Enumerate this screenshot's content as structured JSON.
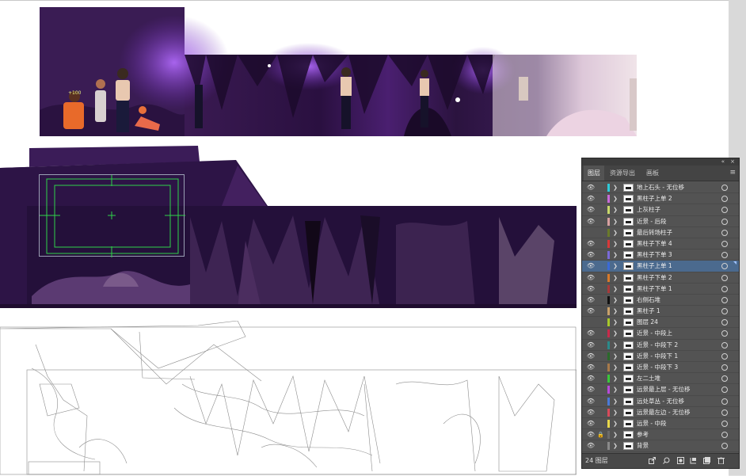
{
  "panel": {
    "collapse_icon": "double-chevron-left",
    "close_icon": "close",
    "collapse_glyph": "«",
    "close_glyph": "×",
    "tabs": [
      {
        "label": "图层",
        "active": true
      },
      {
        "label": "资源导出",
        "active": false
      },
      {
        "label": "画板",
        "active": false
      }
    ],
    "menu_icon": "hamburger",
    "menu_glyph": "≡",
    "eye_glyph": "👁",
    "lock_glyph": "🔒",
    "layers": [
      {
        "name": "地上石头 - 无位移",
        "color": "#2ecad8",
        "visible": true,
        "locked": false,
        "selected": false
      },
      {
        "name": "黑柱子上单 2",
        "color": "#c86ad8",
        "visible": true,
        "locked": false,
        "selected": false
      },
      {
        "name": "上灰柱子",
        "color": "#c8d86a",
        "visible": true,
        "locked": false,
        "selected": false
      },
      {
        "name": "近景 - 后段",
        "color": "#d8a0a0",
        "visible": true,
        "locked": false,
        "selected": false
      },
      {
        "name": "最后转场柱子",
        "color": "#6a7a2a",
        "visible": false,
        "locked": false,
        "selected": false
      },
      {
        "name": "黑柱子下单 4",
        "color": "#d83838",
        "visible": true,
        "locked": false,
        "selected": false
      },
      {
        "name": "黑柱子下单 3",
        "color": "#7a6ad8",
        "visible": true,
        "locked": false,
        "selected": false
      },
      {
        "name": "黑柱子上单 1",
        "color": "#3a6ad8",
        "visible": true,
        "locked": false,
        "selected": true
      },
      {
        "name": "黑柱子下单 2",
        "color": "#d87a2a",
        "visible": true,
        "locked": false,
        "selected": false
      },
      {
        "name": "黑柱子下单 1",
        "color": "#a83a3a",
        "visible": true,
        "locked": false,
        "selected": false
      },
      {
        "name": "右侧石堆",
        "color": "#111111",
        "visible": true,
        "locked": false,
        "selected": false
      },
      {
        "name": "黑柱子 1",
        "color": "#c8a06a",
        "visible": true,
        "locked": false,
        "selected": false
      },
      {
        "name": "图层 24",
        "color": "#a8c82a",
        "visible": false,
        "locked": false,
        "selected": false
      },
      {
        "name": "近景 - 中段上",
        "color": "#c82a4a",
        "visible": true,
        "locked": false,
        "selected": false
      },
      {
        "name": "近景 - 中段下 2",
        "color": "#2a8a8a",
        "visible": true,
        "locked": false,
        "selected": false
      },
      {
        "name": "近景 - 中段下 1",
        "color": "#2a6a2a",
        "visible": true,
        "locked": false,
        "selected": false
      },
      {
        "name": "近景 - 中段下 3",
        "color": "#a87a4a",
        "visible": true,
        "locked": false,
        "selected": false
      },
      {
        "name": "左二土堆",
        "color": "#3ac83a",
        "visible": true,
        "locked": false,
        "selected": false
      },
      {
        "name": "远景最上层 - 无位移",
        "color": "#b84ad8",
        "visible": true,
        "locked": false,
        "selected": false
      },
      {
        "name": "远处草丛 - 无位移",
        "color": "#4a7ad8",
        "visible": true,
        "locked": false,
        "selected": false
      },
      {
        "name": "远景最左边 - 无位移",
        "color": "#d84a5a",
        "visible": true,
        "locked": false,
        "selected": false
      },
      {
        "name": "远景 - 中段",
        "color": "#e8d84a",
        "visible": true,
        "locked": false,
        "selected": false
      },
      {
        "name": "参考",
        "color": "#6a6a6a",
        "visible": true,
        "locked": true,
        "selected": false
      },
      {
        "name": "背景",
        "color": "#8a8a8a",
        "visible": true,
        "locked": false,
        "selected": false
      }
    ],
    "footer": {
      "count_label": "24 图层",
      "icons": [
        "export-icon",
        "search-icon",
        "clip-mask-icon",
        "new-sublayer-icon",
        "new-layer-icon",
        "delete-icon"
      ]
    }
  },
  "artwork": {
    "score_label": "+100"
  }
}
